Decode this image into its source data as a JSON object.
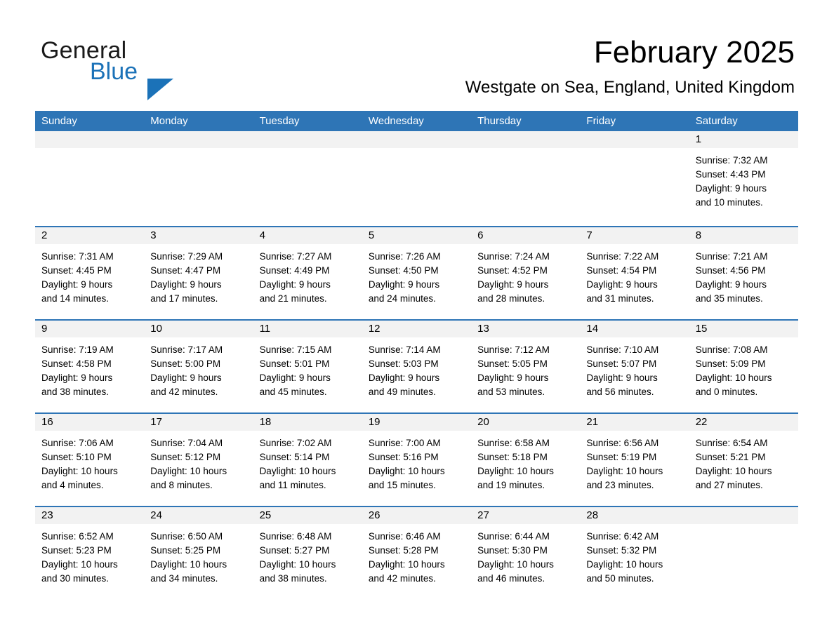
{
  "brand": {
    "name_part1": "General",
    "name_part2": "Blue",
    "accent_color": "#1b72b8"
  },
  "header": {
    "month_title": "February 2025",
    "location": "Westgate on Sea, England, United Kingdom"
  },
  "calendar": {
    "header_color": "#2e75b6",
    "daynumber_band_color": "#f2f2f2",
    "weekdays": [
      "Sunday",
      "Monday",
      "Tuesday",
      "Wednesday",
      "Thursday",
      "Friday",
      "Saturday"
    ],
    "weeks": [
      [
        {
          "day": "",
          "empty": true
        },
        {
          "day": "",
          "empty": true
        },
        {
          "day": "",
          "empty": true
        },
        {
          "day": "",
          "empty": true
        },
        {
          "day": "",
          "empty": true
        },
        {
          "day": "",
          "empty": true
        },
        {
          "day": "1",
          "sunrise": "Sunrise: 7:32 AM",
          "sunset": "Sunset: 4:43 PM",
          "daylight_line1": "Daylight: 9 hours",
          "daylight_line2": "and 10 minutes."
        }
      ],
      [
        {
          "day": "2",
          "sunrise": "Sunrise: 7:31 AM",
          "sunset": "Sunset: 4:45 PM",
          "daylight_line1": "Daylight: 9 hours",
          "daylight_line2": "and 14 minutes."
        },
        {
          "day": "3",
          "sunrise": "Sunrise: 7:29 AM",
          "sunset": "Sunset: 4:47 PM",
          "daylight_line1": "Daylight: 9 hours",
          "daylight_line2": "and 17 minutes."
        },
        {
          "day": "4",
          "sunrise": "Sunrise: 7:27 AM",
          "sunset": "Sunset: 4:49 PM",
          "daylight_line1": "Daylight: 9 hours",
          "daylight_line2": "and 21 minutes."
        },
        {
          "day": "5",
          "sunrise": "Sunrise: 7:26 AM",
          "sunset": "Sunset: 4:50 PM",
          "daylight_line1": "Daylight: 9 hours",
          "daylight_line2": "and 24 minutes."
        },
        {
          "day": "6",
          "sunrise": "Sunrise: 7:24 AM",
          "sunset": "Sunset: 4:52 PM",
          "daylight_line1": "Daylight: 9 hours",
          "daylight_line2": "and 28 minutes."
        },
        {
          "day": "7",
          "sunrise": "Sunrise: 7:22 AM",
          "sunset": "Sunset: 4:54 PM",
          "daylight_line1": "Daylight: 9 hours",
          "daylight_line2": "and 31 minutes."
        },
        {
          "day": "8",
          "sunrise": "Sunrise: 7:21 AM",
          "sunset": "Sunset: 4:56 PM",
          "daylight_line1": "Daylight: 9 hours",
          "daylight_line2": "and 35 minutes."
        }
      ],
      [
        {
          "day": "9",
          "sunrise": "Sunrise: 7:19 AM",
          "sunset": "Sunset: 4:58 PM",
          "daylight_line1": "Daylight: 9 hours",
          "daylight_line2": "and 38 minutes."
        },
        {
          "day": "10",
          "sunrise": "Sunrise: 7:17 AM",
          "sunset": "Sunset: 5:00 PM",
          "daylight_line1": "Daylight: 9 hours",
          "daylight_line2": "and 42 minutes."
        },
        {
          "day": "11",
          "sunrise": "Sunrise: 7:15 AM",
          "sunset": "Sunset: 5:01 PM",
          "daylight_line1": "Daylight: 9 hours",
          "daylight_line2": "and 45 minutes."
        },
        {
          "day": "12",
          "sunrise": "Sunrise: 7:14 AM",
          "sunset": "Sunset: 5:03 PM",
          "daylight_line1": "Daylight: 9 hours",
          "daylight_line2": "and 49 minutes."
        },
        {
          "day": "13",
          "sunrise": "Sunrise: 7:12 AM",
          "sunset": "Sunset: 5:05 PM",
          "daylight_line1": "Daylight: 9 hours",
          "daylight_line2": "and 53 minutes."
        },
        {
          "day": "14",
          "sunrise": "Sunrise: 7:10 AM",
          "sunset": "Sunset: 5:07 PM",
          "daylight_line1": "Daylight: 9 hours",
          "daylight_line2": "and 56 minutes."
        },
        {
          "day": "15",
          "sunrise": "Sunrise: 7:08 AM",
          "sunset": "Sunset: 5:09 PM",
          "daylight_line1": "Daylight: 10 hours",
          "daylight_line2": "and 0 minutes."
        }
      ],
      [
        {
          "day": "16",
          "sunrise": "Sunrise: 7:06 AM",
          "sunset": "Sunset: 5:10 PM",
          "daylight_line1": "Daylight: 10 hours",
          "daylight_line2": "and 4 minutes."
        },
        {
          "day": "17",
          "sunrise": "Sunrise: 7:04 AM",
          "sunset": "Sunset: 5:12 PM",
          "daylight_line1": "Daylight: 10 hours",
          "daylight_line2": "and 8 minutes."
        },
        {
          "day": "18",
          "sunrise": "Sunrise: 7:02 AM",
          "sunset": "Sunset: 5:14 PM",
          "daylight_line1": "Daylight: 10 hours",
          "daylight_line2": "and 11 minutes."
        },
        {
          "day": "19",
          "sunrise": "Sunrise: 7:00 AM",
          "sunset": "Sunset: 5:16 PM",
          "daylight_line1": "Daylight: 10 hours",
          "daylight_line2": "and 15 minutes."
        },
        {
          "day": "20",
          "sunrise": "Sunrise: 6:58 AM",
          "sunset": "Sunset: 5:18 PM",
          "daylight_line1": "Daylight: 10 hours",
          "daylight_line2": "and 19 minutes."
        },
        {
          "day": "21",
          "sunrise": "Sunrise: 6:56 AM",
          "sunset": "Sunset: 5:19 PM",
          "daylight_line1": "Daylight: 10 hours",
          "daylight_line2": "and 23 minutes."
        },
        {
          "day": "22",
          "sunrise": "Sunrise: 6:54 AM",
          "sunset": "Sunset: 5:21 PM",
          "daylight_line1": "Daylight: 10 hours",
          "daylight_line2": "and 27 minutes."
        }
      ],
      [
        {
          "day": "23",
          "sunrise": "Sunrise: 6:52 AM",
          "sunset": "Sunset: 5:23 PM",
          "daylight_line1": "Daylight: 10 hours",
          "daylight_line2": "and 30 minutes."
        },
        {
          "day": "24",
          "sunrise": "Sunrise: 6:50 AM",
          "sunset": "Sunset: 5:25 PM",
          "daylight_line1": "Daylight: 10 hours",
          "daylight_line2": "and 34 minutes."
        },
        {
          "day": "25",
          "sunrise": "Sunrise: 6:48 AM",
          "sunset": "Sunset: 5:27 PM",
          "daylight_line1": "Daylight: 10 hours",
          "daylight_line2": "and 38 minutes."
        },
        {
          "day": "26",
          "sunrise": "Sunrise: 6:46 AM",
          "sunset": "Sunset: 5:28 PM",
          "daylight_line1": "Daylight: 10 hours",
          "daylight_line2": "and 42 minutes."
        },
        {
          "day": "27",
          "sunrise": "Sunrise: 6:44 AM",
          "sunset": "Sunset: 5:30 PM",
          "daylight_line1": "Daylight: 10 hours",
          "daylight_line2": "and 46 minutes."
        },
        {
          "day": "28",
          "sunrise": "Sunrise: 6:42 AM",
          "sunset": "Sunset: 5:32 PM",
          "daylight_line1": "Daylight: 10 hours",
          "daylight_line2": "and 50 minutes."
        },
        {
          "day": "",
          "empty": true
        }
      ]
    ]
  }
}
